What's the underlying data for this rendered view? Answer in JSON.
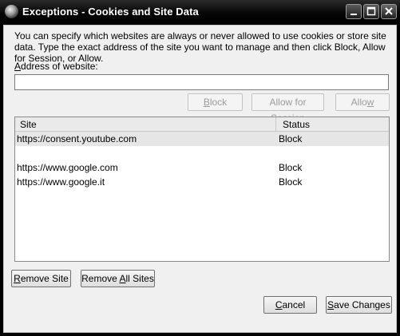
{
  "window": {
    "title": "Exceptions - Cookies and Site Data",
    "controls": [
      "minimize",
      "maximize",
      "close"
    ]
  },
  "intro_text": "You can specify which websites are always or never allowed to use cookies or store site data. Type the exact address of the site you want to manage and then click Block, Allow for Session, or Allow.",
  "address": {
    "label_first": "A",
    "label_rest": "ddress of website:",
    "value": "",
    "placeholder": ""
  },
  "action_buttons": {
    "block_first": "B",
    "block_rest": "lock",
    "session_pre": "Allow for ",
    "session_key": "S",
    "session_post": "ession",
    "allow_pre": "Allo",
    "allow_key": "w"
  },
  "table": {
    "columns": [
      "Site",
      "Status"
    ],
    "rows": [
      {
        "site": "https://consent.youtube.com",
        "status": "Block"
      },
      {
        "site": "https://www.google.com",
        "status": "Block"
      },
      {
        "site": "https://www.google.it",
        "status": "Block"
      }
    ]
  },
  "bottom_buttons": {
    "remove_site_first": "R",
    "remove_site_rest": "emove Site",
    "remove_all_pre": "Remove ",
    "remove_all_key": "A",
    "remove_all_post": "ll Sites",
    "cancel_first": "C",
    "cancel_rest": "ancel",
    "save_first": "S",
    "save_rest": "ave Changes"
  },
  "colors": {
    "titlebar": "#000000",
    "dialog_bg": "#f0f0f0",
    "selected_row": "#e6e6e6",
    "disabled_text": "#9b9b9b"
  }
}
